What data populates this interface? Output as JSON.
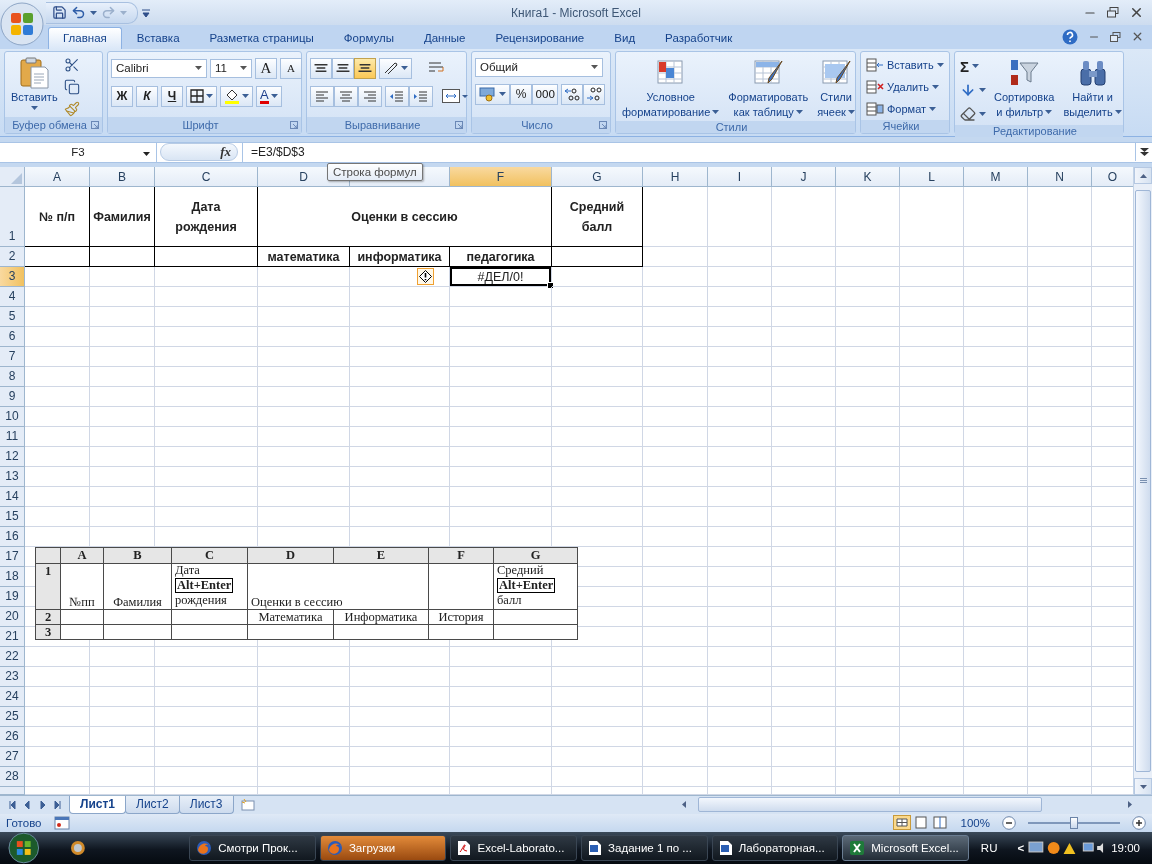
{
  "title_bar": {
    "title": "Книга1 - Microsoft Excel"
  },
  "tabs": [
    {
      "label": "Главная",
      "selected": true
    },
    {
      "label": "Вставка",
      "selected": false
    },
    {
      "label": "Разметка страницы",
      "selected": false
    },
    {
      "label": "Формулы",
      "selected": false
    },
    {
      "label": "Данные",
      "selected": false
    },
    {
      "label": "Рецензирование",
      "selected": false
    },
    {
      "label": "Вид",
      "selected": false
    },
    {
      "label": "Разработчик",
      "selected": false
    }
  ],
  "ribbon": {
    "clipboard": {
      "label": "Буфер обмена",
      "paste": "Вставить"
    },
    "font": {
      "label": "Шрифт",
      "font_name": "Calibri",
      "font_size": "11",
      "grow": "A",
      "shrink": "A",
      "bold": "Ж",
      "italic": "К",
      "underline": "Ч",
      "font_color": "A"
    },
    "alignment": {
      "label": "Выравнивание",
      "vertical": [
        {
          "selected": false
        },
        {
          "selected": false
        },
        {
          "selected": true
        }
      ]
    },
    "number": {
      "label": "Число",
      "format": "Общий",
      "percent": "%",
      "thousands": "000"
    },
    "styles": {
      "label": "Стили",
      "buttons": [
        {
          "lines": [
            "Условное",
            "форматирование"
          ]
        },
        {
          "lines": [
            "Форматировать",
            "как таблицу"
          ]
        },
        {
          "lines": [
            "Стили",
            "ячеек"
          ]
        }
      ]
    },
    "cells": {
      "label": "Ячейки",
      "buttons": [
        "Вставить",
        "Удалить",
        "Формат"
      ]
    },
    "editing": {
      "label": "Редактирование",
      "sum": "Σ",
      "buttons": [
        {
          "lines": [
            "Сортировка",
            "и фильтр"
          ]
        },
        {
          "lines": [
            "Найти и",
            "выделить"
          ]
        }
      ]
    }
  },
  "formula_bar": {
    "name_box": "F3",
    "insert_function": "fx",
    "formula": "=E3/$D$3",
    "tooltip": "Строка формул"
  },
  "sheet": {
    "columns": [
      {
        "label": "A",
        "selected": false
      },
      {
        "label": "B",
        "selected": false
      },
      {
        "label": "C",
        "selected": false
      },
      {
        "label": "D",
        "selected": false
      },
      {
        "selected": false
      },
      {
        "label": "F",
        "selected": true
      },
      {
        "label": "G",
        "selected": false
      },
      {
        "label": "H",
        "selected": false
      },
      {
        "label": "I",
        "selected": false
      },
      {
        "label": "J",
        "selected": false
      },
      {
        "label": "K",
        "selected": false
      },
      {
        "label": "L",
        "selected": false
      },
      {
        "label": "M",
        "selected": false
      },
      {
        "label": "N",
        "selected": false
      },
      {
        "label": "O",
        "selected": false
      }
    ],
    "rows": [
      {
        "number": "1",
        "selected": false,
        "cells": [
          {
            "text": "№ п/п",
            "kind": "cell",
            "bordered": true,
            "selected": false
          },
          {
            "text": "Фамилия",
            "kind": "cell",
            "bordered": true,
            "selected": false
          },
          {
            "text": "Дата\nрождения",
            "kind": "cell",
            "bordered": true,
            "selected": false
          },
          {
            "text": "Оценки в сессию",
            "kind": "cell",
            "bordered": true,
            "selected": false
          },
          {
            "kind": "continued"
          },
          {
            "kind": "continued"
          },
          {
            "text": "Средний\nбалл",
            "kind": "cell",
            "bordered": true,
            "selected": false
          }
        ]
      },
      {
        "number": "2",
        "selected": false,
        "cells": [
          {
            "kind": "cell",
            "bordered": true,
            "selected": false
          },
          {
            "kind": "cell",
            "bordered": true,
            "selected": false
          },
          {
            "kind": "cell",
            "bordered": true,
            "selected": false
          },
          {
            "text": "математика",
            "kind": "cell",
            "bordered": true,
            "selected": false
          },
          {
            "text": "информатика",
            "kind": "cell",
            "bordered": true,
            "selected": false
          },
          {
            "text": "педагогика",
            "kind": "cell",
            "bordered": true,
            "selected": false
          },
          {
            "kind": "cell",
            "bordered": true,
            "selected": false
          }
        ]
      },
      {
        "number": "3",
        "selected": true,
        "cells": [
          {
            "kind": "cell",
            "bordered": false,
            "selected": false,
            "warning": false
          },
          {
            "kind": "cell",
            "bordered": false,
            "selected": false,
            "warning": false
          },
          {
            "kind": "cell",
            "bordered": false,
            "selected": false,
            "warning": false
          },
          {
            "kind": "cell",
            "bordered": false,
            "selected": false,
            "warning": false
          },
          {
            "kind": "cell",
            "bordered": false,
            "selected": false,
            "warning": true
          },
          {
            "text": "#ДЕЛ/0!",
            "kind": "cell",
            "bordered": false,
            "selected": true,
            "warning": false
          }
        ]
      },
      {
        "number": "4",
        "selected": false
      },
      {
        "number": "5",
        "selected": false
      },
      {
        "number": "6",
        "selected": false
      },
      {
        "number": "7",
        "selected": false
      },
      {
        "number": "8",
        "selected": false
      },
      {
        "number": "9",
        "selected": false
      },
      {
        "number": "10",
        "selected": false
      },
      {
        "number": "11",
        "selected": false
      },
      {
        "number": "12",
        "selected": false
      },
      {
        "number": "13",
        "selected": false
      },
      {
        "number": "14",
        "selected": false
      },
      {
        "number": "15",
        "selected": false
      },
      {
        "number": "16",
        "selected": false
      },
      {
        "number": "17",
        "selected": false
      },
      {
        "number": "18",
        "selected": false
      },
      {
        "number": "19",
        "selected": false
      },
      {
        "number": "20",
        "selected": false
      },
      {
        "number": "21",
        "selected": false
      },
      {
        "number": "22",
        "selected": false
      },
      {
        "number": "23",
        "selected": false
      },
      {
        "number": "24",
        "selected": false
      },
      {
        "number": "25",
        "selected": false
      },
      {
        "number": "26",
        "selected": false
      },
      {
        "number": "27",
        "selected": false
      },
      {
        "number": "28",
        "selected": false
      }
    ]
  },
  "embedded_table": {
    "columns": [
      "A",
      "B",
      "C",
      "D",
      "E",
      "F",
      "G"
    ],
    "rows": [
      {
        "number": "1",
        "cells": [
          {
            "kind": "cell",
            "lines": [
              {
                "text": "№пп",
                "kind": "plain"
              }
            ]
          },
          {
            "kind": "cell",
            "lines": [
              {
                "text": "Фамилия",
                "kind": "plain"
              }
            ]
          },
          {
            "kind": "cell",
            "lines": [
              {
                "text": "Дата",
                "kind": "plain"
              },
              {
                "text": "Alt+Enter",
                "kind": "key"
              },
              {
                "text": "рождения",
                "kind": "plain"
              }
            ]
          },
          {
            "kind": "cell",
            "lines": [
              {
                "text": "Оценки в сессию",
                "kind": "plain"
              }
            ]
          },
          {
            "kind": "continued"
          },
          {
            "kind": "cell"
          },
          {
            "kind": "cell",
            "lines": [
              {
                "text": "Средний",
                "kind": "plain"
              },
              {
                "text": "Alt+Enter",
                "kind": "key"
              },
              {
                "text": "балл",
                "kind": "plain"
              }
            ]
          }
        ]
      },
      {
        "number": "2",
        "cells": [
          {
            "kind": "cell"
          },
          {
            "kind": "cell"
          },
          {
            "kind": "cell"
          },
          {
            "kind": "cell",
            "lines": [
              {
                "text": "Математика",
                "kind": "plain"
              }
            ]
          },
          {
            "kind": "cell",
            "lines": [
              {
                "text": "Информатика",
                "kind": "plain"
              }
            ]
          },
          {
            "kind": "cell",
            "lines": [
              {
                "text": "История",
                "kind": "plain"
              }
            ]
          },
          {
            "kind": "cell"
          }
        ]
      },
      {
        "number": "3",
        "cells": [
          {
            "kind": "cell"
          },
          {
            "kind": "cell"
          },
          {
            "kind": "cell"
          },
          {
            "kind": "cell"
          },
          {
            "kind": "cell"
          },
          {
            "kind": "cell"
          },
          {
            "kind": "cell"
          }
        ]
      }
    ]
  },
  "sheet_tabs": [
    {
      "label": "Лист1",
      "selected": true
    },
    {
      "label": "Лист2",
      "selected": false
    },
    {
      "label": "Лист3",
      "selected": false
    }
  ],
  "status_bar": {
    "status": "Готово",
    "zoom": "100%",
    "zoom_slider": {
      "level": 0.5
    }
  },
  "taskbar": {
    "tasks": [
      {
        "label": "Смотри Прок...",
        "kind": "browser",
        "selected": false,
        "flashing": false
      },
      {
        "label": "Загрузки",
        "kind": "browser",
        "selected": false,
        "flashing": true
      },
      {
        "label": "Excel-Laborato...",
        "kind": "pdf",
        "selected": false,
        "flashing": false
      },
      {
        "label": "Задание 1 по ...",
        "kind": "word",
        "selected": false,
        "flashing": false
      },
      {
        "label": "Лабораторная...",
        "kind": "word",
        "selected": false,
        "flashing": false
      },
      {
        "label": "Microsoft Excel...",
        "kind": "excel",
        "selected": true,
        "flashing": false
      }
    ],
    "language": "RU",
    "tray_toggle": "<",
    "clock": "19:00"
  }
}
